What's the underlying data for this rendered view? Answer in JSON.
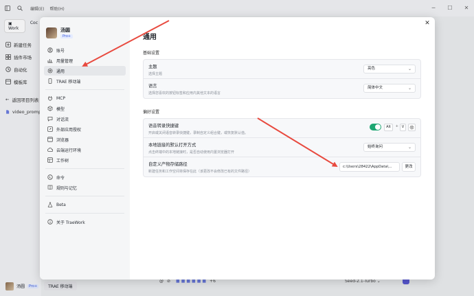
{
  "app": {
    "menu": [
      "编辑(E)",
      "帮助(H)"
    ],
    "tabs": [
      "Work",
      "Coc"
    ],
    "nav": [
      "新建任务",
      "插件市场",
      "自动化",
      "模板库"
    ],
    "back_label": "返回项目列表",
    "file_name": "video_promp",
    "user_name": "汤圆",
    "pro_badge": "Pro+",
    "mobile_label": "TRAE 移动端",
    "bottom_count": "+6",
    "model": "Seed-2.1-Turbo"
  },
  "settings": {
    "profile": {
      "name": "汤圆",
      "badge": "Pro+"
    },
    "nav": [
      {
        "label": "账号",
        "icon": "user-icon"
      },
      {
        "label": "用量管理",
        "icon": "chart-icon"
      },
      {
        "label": "通用",
        "icon": "gear-icon",
        "active": true
      },
      {
        "label": "TRAE 移动端",
        "icon": "mobile-icon"
      },
      {
        "label": "MCP",
        "icon": "plug-icon",
        "group_start": true
      },
      {
        "label": "模型",
        "icon": "cube-icon"
      },
      {
        "label": "对话流",
        "icon": "chat-icon"
      },
      {
        "label": "外部应用授权",
        "icon": "link-icon"
      },
      {
        "label": "浏览器",
        "icon": "browser-icon"
      },
      {
        "label": "云端运行环境",
        "icon": "cloud-icon"
      },
      {
        "label": "工作树",
        "icon": "tree-icon"
      },
      {
        "label": "命令",
        "icon": "terminal-icon",
        "group_start": true
      },
      {
        "label": "规则与记忆",
        "icon": "book-icon"
      },
      {
        "label": "Beta",
        "icon": "flask-icon",
        "group_start": true
      },
      {
        "label": "关于 TraeWork",
        "icon": "info-icon",
        "group_start": true
      }
    ],
    "title": "通用",
    "basic": {
      "section_title": "基础设置",
      "theme": {
        "label": "主题",
        "desc": "选择主题",
        "value": "亮色"
      },
      "language": {
        "label": "语言",
        "desc": "选择您喜欢的按钮标签和应用内其他文本的语言",
        "value": "简体中文"
      }
    },
    "prefs": {
      "section_title": "偏好设置",
      "voice": {
        "label": "语音转录快捷键",
        "desc": "开启或关闭语音转录快捷键，录制自定义组合键，或恢复默认值。",
        "key1": "Alt",
        "plus": "+",
        "key2": "V"
      },
      "link_open": {
        "label": "本地链接的默认打开方式",
        "desc": "点击终端中的本地链接时，是否自动使用内置浏览器打开",
        "value": "始终询问"
      },
      "output_path": {
        "label": "自定义产物存储路径",
        "desc": "新建任务和工作空间将保存在此（该更改不会修改已有的文件路径）",
        "value": "c:\\Users\\28422\\AppData\\...",
        "button": "更改"
      }
    }
  },
  "colors": {
    "accent": "#1ea672",
    "arrow": "#e84a3f",
    "pro": "#3b5bdb"
  }
}
